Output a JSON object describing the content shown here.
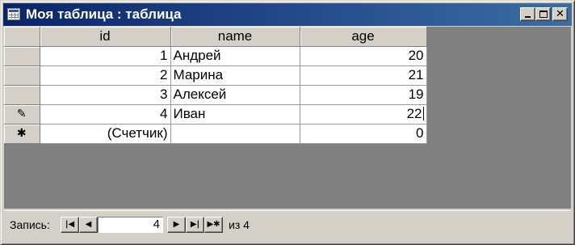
{
  "window": {
    "title": "Моя таблица : таблица",
    "icon": "table-icon",
    "controls": {
      "minimize_icon": "minimize-icon",
      "maximize_icon": "maximize-icon",
      "close_icon": "close-icon"
    }
  },
  "table": {
    "columns": [
      "id",
      "name",
      "age"
    ],
    "rows": [
      {
        "selector": "",
        "id": "1",
        "name": "Андрей",
        "age": "20"
      },
      {
        "selector": "",
        "id": "2",
        "name": "Марина",
        "age": "21"
      },
      {
        "selector": "",
        "id": "3",
        "name": "Алексей",
        "age": "19"
      },
      {
        "selector": "✎",
        "id": "4",
        "name": "Иван",
        "age": "22"
      }
    ],
    "new_row": {
      "selector": "✱",
      "id": "(Счетчик)",
      "name": "",
      "age": "0"
    }
  },
  "navigation": {
    "label": "Запись:",
    "current_record": "4",
    "of_label": "из 4",
    "icons": {
      "first": "first-record-icon",
      "prev": "previous-record-icon",
      "next": "next-record-icon",
      "last": "last-record-icon",
      "new": "new-record-icon"
    }
  },
  "colors": {
    "titlebar_start": "#0a246a",
    "titlebar_end": "#3a6ea5",
    "face": "#d4d0c8",
    "background": "#808080"
  }
}
